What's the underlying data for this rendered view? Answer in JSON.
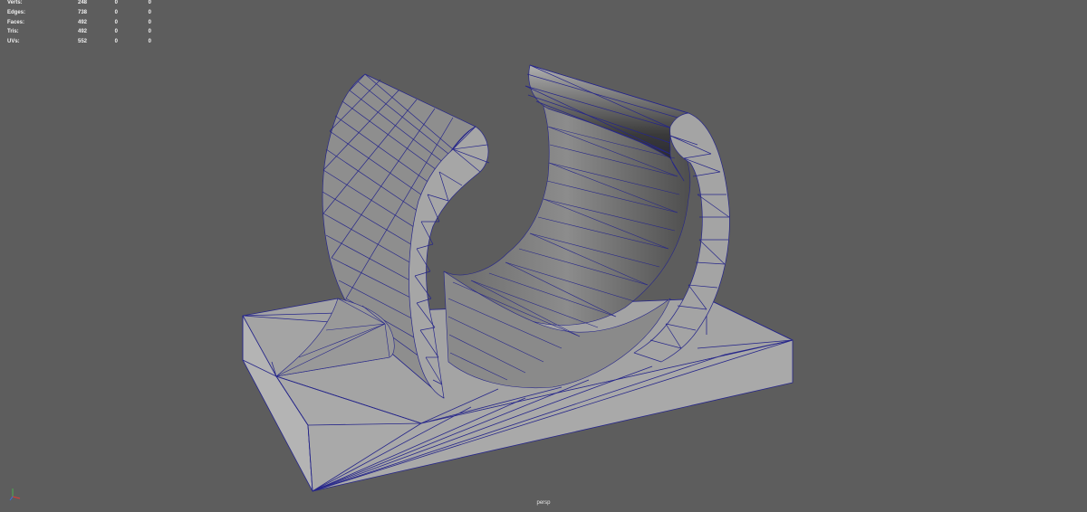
{
  "hud": {
    "rows": [
      {
        "label": "Verts:",
        "total": "248",
        "selected": "0",
        "extra": "0"
      },
      {
        "label": "Edges:",
        "total": "738",
        "selected": "0",
        "extra": "0"
      },
      {
        "label": "Faces:",
        "total": "492",
        "selected": "0",
        "extra": "0"
      },
      {
        "label": "Tris:",
        "total": "492",
        "selected": "0",
        "extra": "0"
      },
      {
        "label": "UVs:",
        "total": "552",
        "selected": "0",
        "extra": "0"
      }
    ]
  },
  "camera": {
    "label": "persp"
  },
  "colors": {
    "background": "#5d5d5d",
    "surface_light": "#a3a3a3",
    "surface_mid": "#8e8e8e",
    "surface_dark": "#555555",
    "wire": "#26268a"
  },
  "axis_icons": [
    "axis-x-icon",
    "axis-y-icon",
    "axis-z-icon"
  ]
}
